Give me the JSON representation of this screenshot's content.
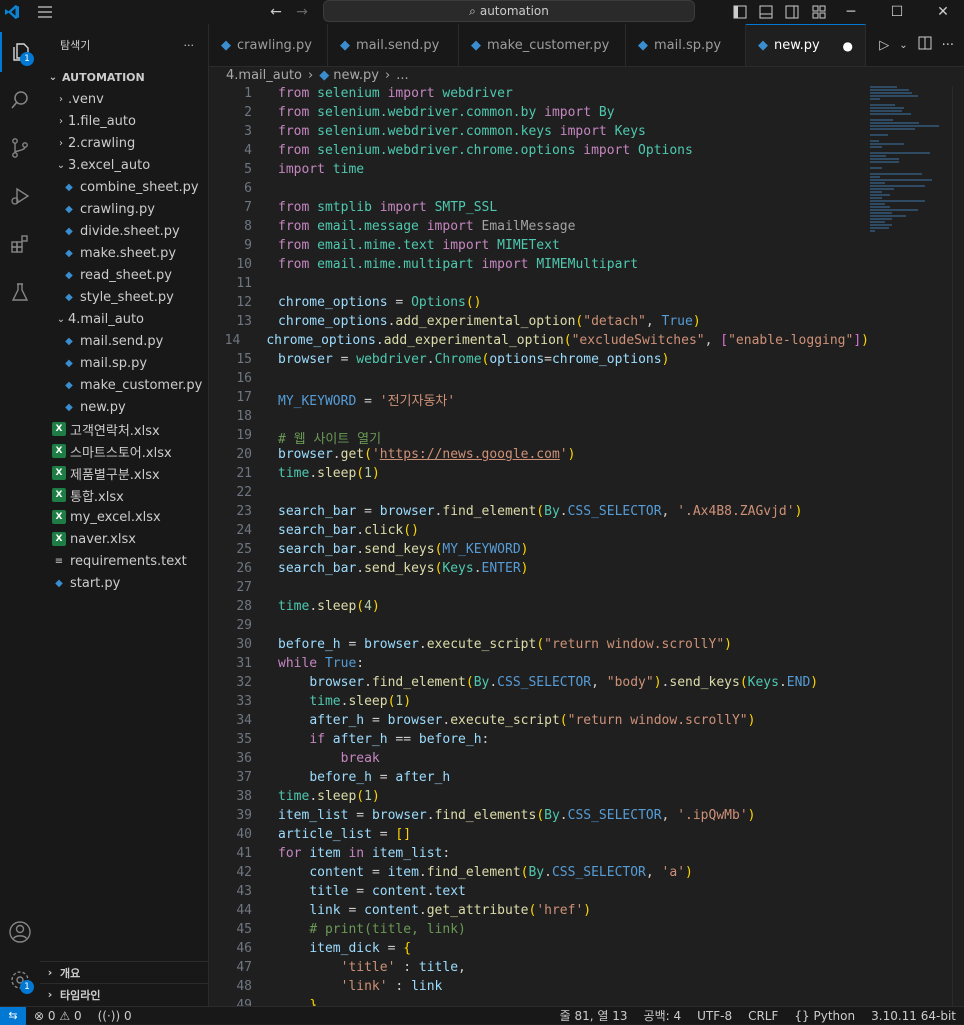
{
  "titlebar": {
    "search_text": "automation",
    "icons": [
      "vscode-logo-icon",
      "menu-icon",
      "back-arrow-icon",
      "forward-arrow-icon",
      "toggle-sidebar-icon",
      "toggle-panel-icon",
      "toggle-secondary-sidebar-icon",
      "customize-layout-icon",
      "minimize-icon",
      "maximize-icon",
      "close-icon"
    ]
  },
  "activitybar": {
    "explorer_badge": "1",
    "accounts": "account-icon",
    "settings_badge": "1"
  },
  "sidebar": {
    "title": "탐색기",
    "more": "···",
    "root": "AUTOMATION",
    "items": [
      {
        "label": ".venv",
        "type": "folder",
        "depth": 1,
        "expanded": false
      },
      {
        "label": "1.file_auto",
        "type": "folder",
        "depth": 1,
        "expanded": false
      },
      {
        "label": "2.crawling",
        "type": "folder",
        "depth": 1,
        "expanded": false
      },
      {
        "label": "3.excel_auto",
        "type": "folder",
        "depth": 1,
        "expanded": true
      },
      {
        "label": "combine_sheet.py",
        "type": "py",
        "depth": 2
      },
      {
        "label": "crawling.py",
        "type": "py",
        "depth": 2
      },
      {
        "label": "divide.sheet.py",
        "type": "py",
        "depth": 2
      },
      {
        "label": "make.sheet.py",
        "type": "py",
        "depth": 2
      },
      {
        "label": "read_sheet.py",
        "type": "py",
        "depth": 2
      },
      {
        "label": "style_sheet.py",
        "type": "py",
        "depth": 2
      },
      {
        "label": "4.mail_auto",
        "type": "folder",
        "depth": 1,
        "expanded": true
      },
      {
        "label": "mail.send.py",
        "type": "py",
        "depth": 2
      },
      {
        "label": "mail.sp.py",
        "type": "py",
        "depth": 2
      },
      {
        "label": "make_customer.py",
        "type": "py",
        "depth": 2
      },
      {
        "label": "new.py",
        "type": "py",
        "depth": 2
      },
      {
        "label": "고객연락처.xlsx",
        "type": "xlsx",
        "depth": 1
      },
      {
        "label": "스마트스토어.xlsx",
        "type": "xlsx",
        "depth": 1
      },
      {
        "label": "제품별구분.xlsx",
        "type": "xlsx",
        "depth": 1
      },
      {
        "label": "통합.xlsx",
        "type": "xlsx",
        "depth": 1
      },
      {
        "label": "my_excel.xlsx",
        "type": "xlsx",
        "depth": 1
      },
      {
        "label": "naver.xlsx",
        "type": "xlsx",
        "depth": 1
      },
      {
        "label": "requirements.text",
        "type": "txt",
        "depth": 1
      },
      {
        "label": "start.py",
        "type": "py",
        "depth": 1
      }
    ],
    "outline": "개요",
    "timeline": "타임라인"
  },
  "tabs": [
    {
      "label": "crawling.py",
      "active": false
    },
    {
      "label": "mail.send.py",
      "active": false
    },
    {
      "label": "make_customer.py",
      "active": false
    },
    {
      "label": "mail.sp.py",
      "active": false
    },
    {
      "label": "new.py",
      "active": true,
      "dirty": true
    }
  ],
  "breadcrumb": {
    "folder": "4.mail_auto",
    "file": "new.py",
    "more": "..."
  },
  "code_lines": [
    [
      [
        "kw",
        "from "
      ],
      [
        "mod",
        "selenium "
      ],
      [
        "kw",
        "import "
      ],
      [
        "mod",
        "webdriver"
      ]
    ],
    [
      [
        "kw",
        "from "
      ],
      [
        "mod",
        "selenium.webdriver.common.by "
      ],
      [
        "kw",
        "import "
      ],
      [
        "cls",
        "By"
      ]
    ],
    [
      [
        "kw",
        "from "
      ],
      [
        "mod",
        "selenium.webdriver.common.keys "
      ],
      [
        "kw",
        "import "
      ],
      [
        "cls",
        "Keys"
      ]
    ],
    [
      [
        "kw",
        "from "
      ],
      [
        "mod",
        "selenium.webdriver.chrome.options "
      ],
      [
        "kw",
        "import "
      ],
      [
        "cls",
        "Options"
      ]
    ],
    [
      [
        "kw",
        "import "
      ],
      [
        "mod",
        "time"
      ]
    ],
    [],
    [
      [
        "kw",
        "from "
      ],
      [
        "mod",
        "smtplib "
      ],
      [
        "kw",
        "import "
      ],
      [
        "cls",
        "SMTP_SSL"
      ]
    ],
    [
      [
        "kw",
        "from "
      ],
      [
        "mod",
        "email.message "
      ],
      [
        "kw",
        "import "
      ],
      [
        "dim",
        "EmailMessage"
      ]
    ],
    [
      [
        "kw",
        "from "
      ],
      [
        "mod",
        "email.mime.text "
      ],
      [
        "kw",
        "import "
      ],
      [
        "cls",
        "MIMEText"
      ]
    ],
    [
      [
        "kw",
        "from "
      ],
      [
        "mod",
        "email.mime.multipart "
      ],
      [
        "kw",
        "import "
      ],
      [
        "cls",
        "MIMEMultipart"
      ]
    ],
    [],
    [
      [
        "var",
        "chrome_options "
      ],
      [
        "pun",
        "= "
      ],
      [
        "cls",
        "Options"
      ],
      [
        "y",
        "()"
      ]
    ],
    [
      [
        "var",
        "chrome_options"
      ],
      [
        "pun",
        "."
      ],
      [
        "fn",
        "add_experimental_option"
      ],
      [
        "y",
        "("
      ],
      [
        "str",
        "\"detach\""
      ],
      [
        "pun",
        ", "
      ],
      [
        "con",
        "True"
      ],
      [
        "y",
        ")"
      ]
    ],
    [
      [
        "var",
        "chrome_options"
      ],
      [
        "pun",
        "."
      ],
      [
        "fn",
        "add_experimental_option"
      ],
      [
        "y",
        "("
      ],
      [
        "str",
        "\"excludeSwitches\""
      ],
      [
        "pun",
        ", "
      ],
      [
        "p",
        "["
      ],
      [
        "str",
        "\"enable-logging\""
      ],
      [
        "p",
        "]"
      ],
      [
        "y",
        ")"
      ]
    ],
    [
      [
        "var",
        "browser "
      ],
      [
        "pun",
        "= "
      ],
      [
        "mod",
        "webdriver"
      ],
      [
        "pun",
        "."
      ],
      [
        "cls",
        "Chrome"
      ],
      [
        "y",
        "("
      ],
      [
        "var",
        "options"
      ],
      [
        "pun",
        "="
      ],
      [
        "var",
        "chrome_options"
      ],
      [
        "y",
        ")"
      ]
    ],
    [],
    [
      [
        "con",
        "MY_KEYWORD "
      ],
      [
        "pun",
        "= "
      ],
      [
        "str",
        "'전기자동차'"
      ]
    ],
    [],
    [
      [
        "cmt",
        "# 웹 사이트 열기"
      ]
    ],
    [
      [
        "var",
        "browser"
      ],
      [
        "pun",
        "."
      ],
      [
        "fn",
        "get"
      ],
      [
        "y",
        "("
      ],
      [
        "str",
        "'"
      ],
      [
        "link",
        "https://news.google.com"
      ],
      [
        "str",
        "'"
      ],
      [
        "y",
        ")"
      ]
    ],
    [
      [
        "mod",
        "time"
      ],
      [
        "pun",
        "."
      ],
      [
        "fn",
        "sleep"
      ],
      [
        "y",
        "("
      ],
      [
        "num",
        "1"
      ],
      [
        "y",
        ")"
      ]
    ],
    [],
    [
      [
        "var",
        "search_bar "
      ],
      [
        "pun",
        "= "
      ],
      [
        "var",
        "browser"
      ],
      [
        "pun",
        "."
      ],
      [
        "fn",
        "find_element"
      ],
      [
        "y",
        "("
      ],
      [
        "cls",
        "By"
      ],
      [
        "pun",
        "."
      ],
      [
        "con",
        "CSS_SELECTOR"
      ],
      [
        "pun",
        ", "
      ],
      [
        "str",
        "'.Ax4B8.ZAGvjd'"
      ],
      [
        "y",
        ")"
      ]
    ],
    [
      [
        "var",
        "search_bar"
      ],
      [
        "pun",
        "."
      ],
      [
        "fn",
        "click"
      ],
      [
        "y",
        "()"
      ]
    ],
    [
      [
        "var",
        "search_bar"
      ],
      [
        "pun",
        "."
      ],
      [
        "fn",
        "send_keys"
      ],
      [
        "y",
        "("
      ],
      [
        "con",
        "MY_KEYWORD"
      ],
      [
        "y",
        ")"
      ]
    ],
    [
      [
        "var",
        "search_bar"
      ],
      [
        "pun",
        "."
      ],
      [
        "fn",
        "send_keys"
      ],
      [
        "y",
        "("
      ],
      [
        "cls",
        "Keys"
      ],
      [
        "pun",
        "."
      ],
      [
        "con",
        "ENTER"
      ],
      [
        "y",
        ")"
      ]
    ],
    [],
    [
      [
        "mod",
        "time"
      ],
      [
        "pun",
        "."
      ],
      [
        "fn",
        "sleep"
      ],
      [
        "y",
        "("
      ],
      [
        "num",
        "4"
      ],
      [
        "y",
        ")"
      ]
    ],
    [],
    [
      [
        "var",
        "before_h "
      ],
      [
        "pun",
        "= "
      ],
      [
        "var",
        "browser"
      ],
      [
        "pun",
        "."
      ],
      [
        "fn",
        "execute_script"
      ],
      [
        "y",
        "("
      ],
      [
        "str",
        "\"return window.scrollY\""
      ],
      [
        "y",
        ")"
      ]
    ],
    [
      [
        "kw",
        "while "
      ],
      [
        "con",
        "True"
      ],
      [
        "pun",
        ":"
      ]
    ],
    [
      [
        "pun",
        "    "
      ],
      [
        "var",
        "browser"
      ],
      [
        "pun",
        "."
      ],
      [
        "fn",
        "find_element"
      ],
      [
        "y",
        "("
      ],
      [
        "cls",
        "By"
      ],
      [
        "pun",
        "."
      ],
      [
        "con",
        "CSS_SELECTOR"
      ],
      [
        "pun",
        ", "
      ],
      [
        "str",
        "\"body\""
      ],
      [
        "y",
        ")"
      ],
      [
        "pun",
        "."
      ],
      [
        "fn",
        "send_keys"
      ],
      [
        "y",
        "("
      ],
      [
        "cls",
        "Keys"
      ],
      [
        "pun",
        "."
      ],
      [
        "con",
        "END"
      ],
      [
        "y",
        ")"
      ]
    ],
    [
      [
        "pun",
        "    "
      ],
      [
        "mod",
        "time"
      ],
      [
        "pun",
        "."
      ],
      [
        "fn",
        "sleep"
      ],
      [
        "y",
        "("
      ],
      [
        "num",
        "1"
      ],
      [
        "y",
        ")"
      ]
    ],
    [
      [
        "pun",
        "    "
      ],
      [
        "var",
        "after_h "
      ],
      [
        "pun",
        "= "
      ],
      [
        "var",
        "browser"
      ],
      [
        "pun",
        "."
      ],
      [
        "fn",
        "execute_script"
      ],
      [
        "y",
        "("
      ],
      [
        "str",
        "\"return window.scrollY\""
      ],
      [
        "y",
        ")"
      ]
    ],
    [
      [
        "pun",
        "    "
      ],
      [
        "kw",
        "if "
      ],
      [
        "var",
        "after_h "
      ],
      [
        "pun",
        "== "
      ],
      [
        "var",
        "before_h"
      ],
      [
        "pun",
        ":"
      ]
    ],
    [
      [
        "pun",
        "        "
      ],
      [
        "kw",
        "break"
      ]
    ],
    [
      [
        "pun",
        "    "
      ],
      [
        "var",
        "before_h "
      ],
      [
        "pun",
        "= "
      ],
      [
        "var",
        "after_h"
      ]
    ],
    [
      [
        "mod",
        "time"
      ],
      [
        "pun",
        "."
      ],
      [
        "fn",
        "sleep"
      ],
      [
        "y",
        "("
      ],
      [
        "num",
        "1"
      ],
      [
        "y",
        ")"
      ]
    ],
    [
      [
        "var",
        "item_list "
      ],
      [
        "pun",
        "= "
      ],
      [
        "var",
        "browser"
      ],
      [
        "pun",
        "."
      ],
      [
        "fn",
        "find_elements"
      ],
      [
        "y",
        "("
      ],
      [
        "cls",
        "By"
      ],
      [
        "pun",
        "."
      ],
      [
        "con",
        "CSS_SELECTOR"
      ],
      [
        "pun",
        ", "
      ],
      [
        "str",
        "'.ipQwMb'"
      ],
      [
        "y",
        ")"
      ]
    ],
    [
      [
        "var",
        "article_list "
      ],
      [
        "pun",
        "= "
      ],
      [
        "y",
        "[]"
      ]
    ],
    [
      [
        "kw",
        "for "
      ],
      [
        "var",
        "item "
      ],
      [
        "kw",
        "in "
      ],
      [
        "var",
        "item_list"
      ],
      [
        "pun",
        ":"
      ]
    ],
    [
      [
        "pun",
        "    "
      ],
      [
        "var",
        "content "
      ],
      [
        "pun",
        "= "
      ],
      [
        "var",
        "item"
      ],
      [
        "pun",
        "."
      ],
      [
        "fn",
        "find_element"
      ],
      [
        "y",
        "("
      ],
      [
        "cls",
        "By"
      ],
      [
        "pun",
        "."
      ],
      [
        "con",
        "CSS_SELECTOR"
      ],
      [
        "pun",
        ", "
      ],
      [
        "str",
        "'a'"
      ],
      [
        "y",
        ")"
      ]
    ],
    [
      [
        "pun",
        "    "
      ],
      [
        "var",
        "title "
      ],
      [
        "pun",
        "= "
      ],
      [
        "var",
        "content"
      ],
      [
        "pun",
        "."
      ],
      [
        "var",
        "text"
      ]
    ],
    [
      [
        "pun",
        "    "
      ],
      [
        "var",
        "link "
      ],
      [
        "pun",
        "= "
      ],
      [
        "var",
        "content"
      ],
      [
        "pun",
        "."
      ],
      [
        "fn",
        "get_attribute"
      ],
      [
        "y",
        "("
      ],
      [
        "str",
        "'href'"
      ],
      [
        "y",
        ")"
      ]
    ],
    [
      [
        "pun",
        "    "
      ],
      [
        "cmt",
        "# print(title, link)"
      ]
    ],
    [
      [
        "pun",
        "    "
      ],
      [
        "var",
        "item_dick "
      ],
      [
        "pun",
        "= "
      ],
      [
        "y",
        "{"
      ]
    ],
    [
      [
        "pun",
        "        "
      ],
      [
        "str",
        "'title' "
      ],
      [
        "pun",
        ": "
      ],
      [
        "var",
        "title"
      ],
      [
        "pun",
        ","
      ]
    ],
    [
      [
        "pun",
        "        "
      ],
      [
        "str",
        "'link' "
      ],
      [
        "pun",
        ": "
      ],
      [
        "var",
        "link"
      ]
    ],
    [
      [
        "pun",
        "    "
      ],
      [
        "y",
        "}"
      ]
    ]
  ],
  "statusbar": {
    "errors": "0",
    "warnings": "0",
    "ports": "0",
    "position": "줄 81, 열 13",
    "spaces": "공백: 4",
    "encoding": "UTF-8",
    "eol": "CRLF",
    "language": "Python",
    "interpreter": "3.10.11 64-bit"
  }
}
